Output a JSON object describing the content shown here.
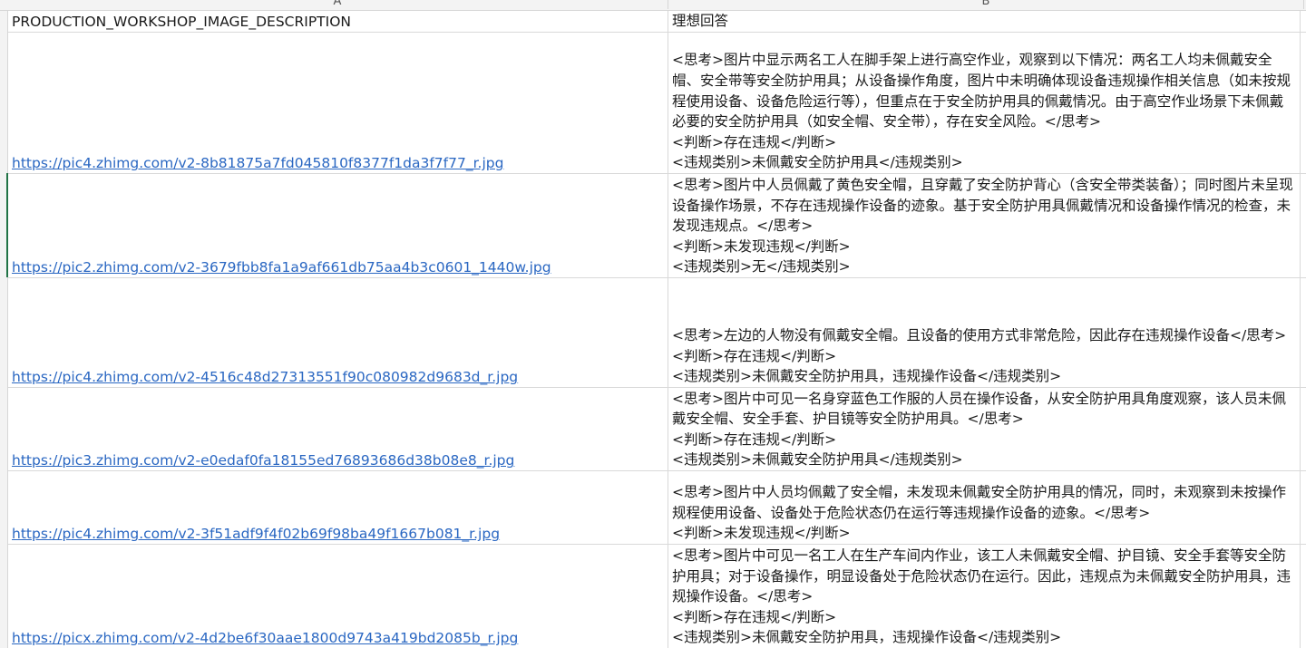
{
  "columns": [
    "A",
    "B"
  ],
  "header": {
    "col_a": "PRODUCTION_WORKSHOP_IMAGE_DESCRIPTION",
    "col_b": "理想回答"
  },
  "rows": [
    {
      "url": "https://pic4.zhimg.com/v2-8b81875a7fd045810f8377f1da3f7f77_r.jpg",
      "answer": "<思考>图片中显示两名工人在脚手架上进行高空作业，观察到以下情况：两名工人均未佩戴安全帽、安全带等安全防护用具；从设备操作角度，图片中未明确体现设备违规操作相关信息（如未按规程使用设备、设备危险运行等），但重点在于安全防护用具的佩戴情况。由于高空作业场景下未佩戴必要的安全防护用具（如安全帽、安全带），存在安全风险。</思考>\n<判断>存在违规</判断>\n<违规类别>未佩戴安全防护用具</违规类别>"
    },
    {
      "url": "https://pic2.zhimg.com/v2-3679fbb8fa1a9af661db75aa4b3c0601_1440w.jpg",
      "answer": "<思考>图片中人员佩戴了黄色安全帽，且穿戴了安全防护背心（含安全带类装备）；同时图片未呈现设备操作场景，不存在违规操作设备的迹象。基于安全防护用具佩戴情况和设备操作情况的检查，未发现违规点。</思考>\n<判断>未发现违规</判断>\n<违规类别>无</违规类别>"
    },
    {
      "url": "https://pic4.zhimg.com/v2-4516c48d27313551f90c080982d9683d_r.jpg",
      "answer": "<思考>左边的人物没有佩戴安全帽。且设备的使用方式非常危险，因此存在违规操作设备</思考>\n<判断>存在违规</判断>\n<违规类别>未佩戴安全防护用具，违规操作设备</违规类别>"
    },
    {
      "url": "https://pic3.zhimg.com/v2-e0edaf0fa18155ed76893686d38b08e8_r.jpg",
      "answer": "<思考>图片中可见一名身穿蓝色工作服的人员在操作设备，从安全防护用具角度观察，该人员未佩戴安全帽、安全手套、护目镜等安全防护用具。</思考>\n<判断>存在违规</判断>\n<违规类别>未佩戴安全防护用具</违规类别>"
    },
    {
      "url": "https://pic4.zhimg.com/v2-3f51adf9f4f02b69f98ba49f1667b081_r.jpg",
      "answer": "<思考>图片中人员均佩戴了安全帽，未发现未佩戴安全防护用具的情况，同时，未观察到未按操作规程使用设备、设备处于危险状态仍在运行等违规操作设备的迹象。</思考>\n<判断>未发现违规</判断>"
    },
    {
      "url": "https://picx.zhimg.com/v2-4d2be6f30aae1800d9743a419bd2085b_r.jpg",
      "answer": "<思考>图片中可见一名工人在生产车间内作业，该工人未佩戴安全帽、护目镜、安全手套等安全防护用具；对于设备操作，明显设备处于危险状态仍在运行。因此，违规点为未佩戴安全防护用具，违规操作设备。</思考>\n<判断>存在违规</判断>\n<违规类别>未佩戴安全防护用具，违规操作设备</违规类别>"
    }
  ]
}
